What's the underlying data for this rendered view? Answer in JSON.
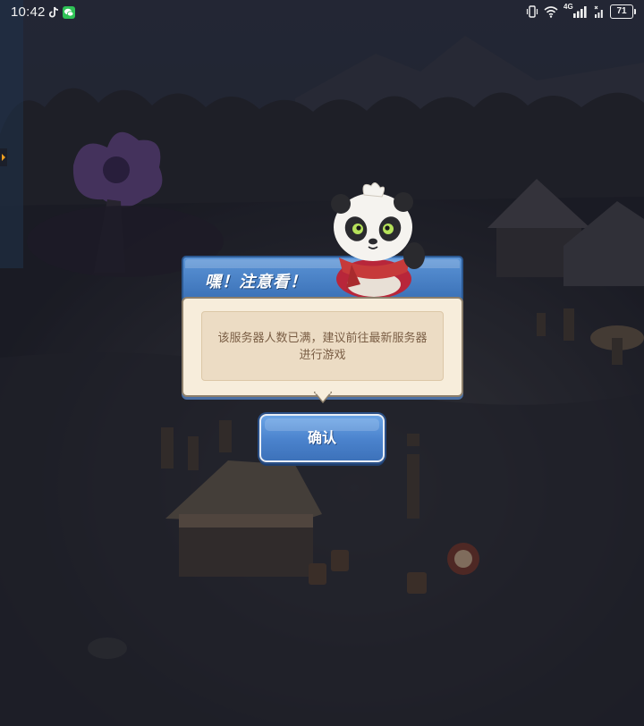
{
  "status_bar": {
    "time": "10:42",
    "battery": "71",
    "network": "4G"
  },
  "dialog": {
    "title": "嘿！注意看！",
    "message": "该服务器人数已满，建议前往最新服务器进行游戏",
    "confirm_label": "确认"
  },
  "colors": {
    "header_blue": "#4a82cc",
    "panel_cream": "#f7eddb",
    "message_text": "#7a5e45",
    "button_blue": "#4a82cc"
  }
}
